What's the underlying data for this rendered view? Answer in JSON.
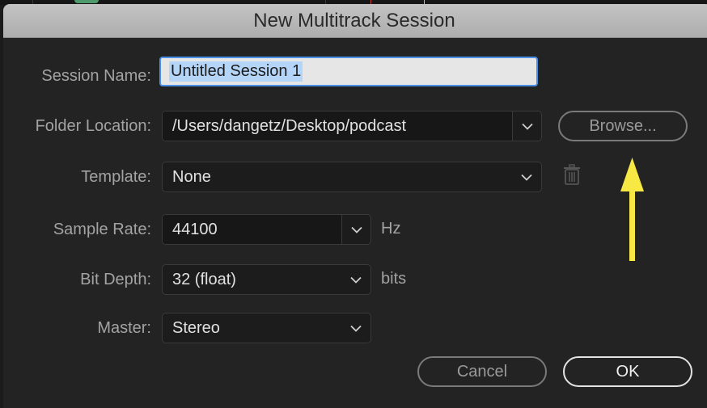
{
  "dialog": {
    "title": "New Multitrack Session"
  },
  "form": {
    "session_name": {
      "label": "Session Name:",
      "value": "Untitled Session 1"
    },
    "folder_location": {
      "label": "Folder Location:",
      "value": "/Users/dangetz/Desktop/podcast",
      "browse_label": "Browse..."
    },
    "template": {
      "label": "Template:",
      "value": "None"
    },
    "sample_rate": {
      "label": "Sample Rate:",
      "value": "44100",
      "unit": "Hz"
    },
    "bit_depth": {
      "label": "Bit Depth:",
      "value": "32 (float)",
      "unit": "bits"
    },
    "master": {
      "label": "Master:",
      "value": "Stereo"
    }
  },
  "buttons": {
    "cancel": "Cancel",
    "ok": "OK"
  },
  "icons": {
    "dropdown": "chevron-down-icon",
    "delete_template": "trash-icon",
    "annotation": "arrow-up-icon"
  },
  "colors": {
    "annotation_arrow": "#f7e843",
    "focus_ring": "#4b8fe6",
    "selection": "#b4d4f8"
  }
}
